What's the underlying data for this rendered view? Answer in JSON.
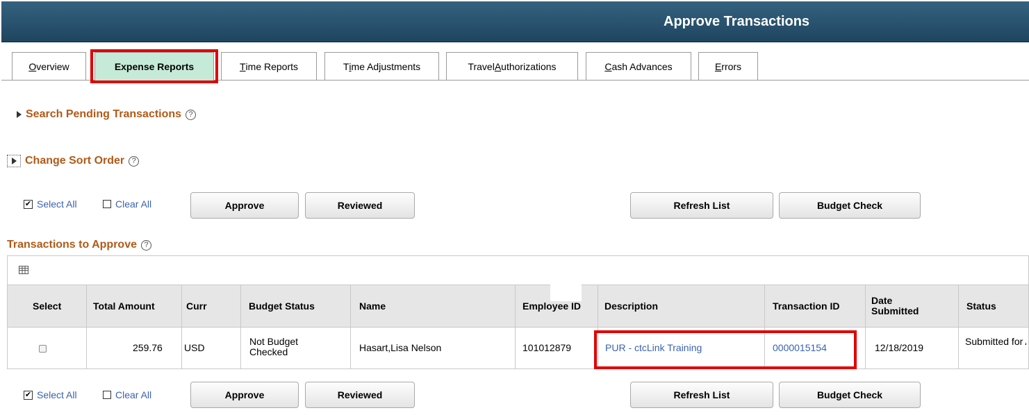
{
  "header": {
    "title": "Approve Transactions"
  },
  "tabs": [
    {
      "pre": "",
      "u": "O",
      "post": "verview",
      "active": false
    },
    {
      "pre": "Expense Reports",
      "u": "",
      "post": "",
      "active": true
    },
    {
      "pre": "",
      "u": "T",
      "post": "ime Reports",
      "active": false
    },
    {
      "pre": "T",
      "u": "i",
      "post": "me Adjustments",
      "active": false
    },
    {
      "pre": "Travel ",
      "u": "A",
      "post": "uthorizations",
      "active": false
    },
    {
      "pre": "",
      "u": "C",
      "post": "ash Advances",
      "active": false
    },
    {
      "pre": "",
      "u": "E",
      "post": "rrors",
      "active": false
    }
  ],
  "sections": {
    "search": "Search Pending Transactions",
    "sort": "Change Sort Order",
    "grid": "Transactions to Approve"
  },
  "actions": {
    "select_all": "Select All",
    "clear_all": "Clear All",
    "approve": "Approve",
    "reviewed": "Reviewed",
    "refresh": "Refresh List",
    "budget_check": "Budget Check"
  },
  "table": {
    "headers": {
      "select": "Select",
      "total_amount": "Total Amount",
      "curr": "Curr",
      "budget_status": "Budget Status",
      "name": "Name",
      "employee_id": "Employee ID",
      "description": "Description",
      "transaction_id": "Transaction ID",
      "date_submitted": "Date Submitted",
      "status": "Status"
    },
    "rows": [
      {
        "total_amount": "259.76",
        "curr": "USD",
        "budget_status": "Not Budget Checked",
        "name": "Hasart,Lisa Nelson",
        "employee_id": "101012879",
        "description": "PUR - ctcLink Training",
        "transaction_id": "0000015154",
        "date_submitted": "12/18/2019",
        "status": "Submitted for Approval"
      }
    ]
  },
  "colors": {
    "accent_red": "#e10000",
    "link_blue": "#3a62b0",
    "section_brown": "#b05a18",
    "active_tab": "#c6ead8"
  }
}
